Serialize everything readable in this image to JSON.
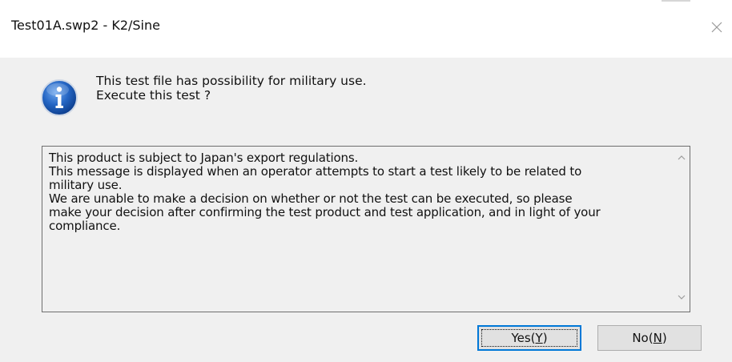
{
  "window": {
    "title": "Test01A.swp2 - K2/Sine",
    "close_glyph": "×"
  },
  "message": {
    "icon": "info-icon",
    "line1": "This test file has possibility for military use.",
    "line2": "Execute this test ?"
  },
  "notice": {
    "text": "This product is subject to Japan's export regulations.\nThis message is displayed when an operator attempts to start a test likely to be related to\nmilitary use.\nWe are unable to make a decision on whether or not the test can be executed, so please\nmake your decision after confirming the test product and test application, and in light of your\ncompliance."
  },
  "buttons": {
    "yes_label": "Yes(",
    "yes_mnemonic": "Y",
    "yes_close": ")",
    "no_label": "No(",
    "no_mnemonic": "N",
    "no_close": ")"
  },
  "colors": {
    "dialog_bg": "#f0f0f0",
    "titlebar_bg": "#ffffff",
    "info_blue": "#1a5fb4",
    "focus_border": "#0078d7"
  }
}
